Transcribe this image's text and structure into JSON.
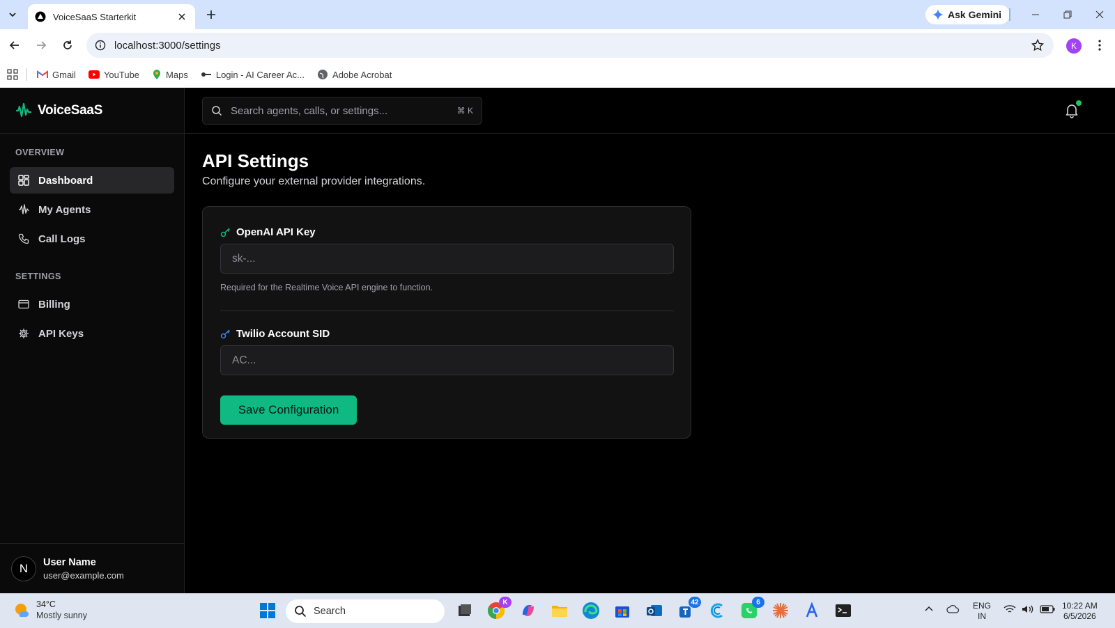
{
  "browser": {
    "tab_title": "VoiceSaaS Starterkit",
    "ask_gemini": "Ask Gemini",
    "url": "localhost:3000/settings",
    "profile_initial": "K",
    "bookmarks": [
      "Gmail",
      "YouTube",
      "Maps",
      "Login - AI Career Ac...",
      "Adobe Acrobat"
    ]
  },
  "app": {
    "brand": "VoiceSaaS",
    "search_placeholder": "Search agents, calls, or settings...",
    "search_shortcut": "⌘ K",
    "sidebar": {
      "overview_label": "OVERVIEW",
      "overview_items": [
        {
          "label": "Dashboard",
          "icon": "dashboard-icon",
          "active": true
        },
        {
          "label": "My Agents",
          "icon": "waveform-icon"
        },
        {
          "label": "Call Logs",
          "icon": "phone-icon"
        }
      ],
      "settings_label": "SETTINGS",
      "settings_items": [
        {
          "label": "Billing",
          "icon": "credit-card-icon"
        },
        {
          "label": "API Keys",
          "icon": "gear-icon"
        }
      ]
    },
    "user": {
      "initial": "N",
      "name": "User Name",
      "email": "user@example.com"
    },
    "page": {
      "title": "API Settings",
      "subtitle": "Configure your external provider integrations.",
      "fields": [
        {
          "label": "OpenAI API Key",
          "placeholder": "sk-...",
          "help": "Required for the Realtime Voice API engine to function.",
          "icon_color": "#10b981"
        },
        {
          "label": "Twilio Account SID",
          "placeholder": "AC...",
          "icon_color": "#3b82f6"
        }
      ],
      "save_label": "Save Configuration"
    },
    "colors": {
      "accent": "#10b981",
      "notification_dot": "#22c55e"
    }
  },
  "taskbar": {
    "weather_temp": "34°C",
    "weather_desc": "Mostly sunny",
    "search_label": "Search",
    "badges": {
      "teams": "42",
      "whatsapp": "6"
    },
    "chrome_badge": "K",
    "lang_1": "ENG",
    "lang_2": "IN",
    "time": "10:22 AM",
    "date": "6/5/2026"
  }
}
